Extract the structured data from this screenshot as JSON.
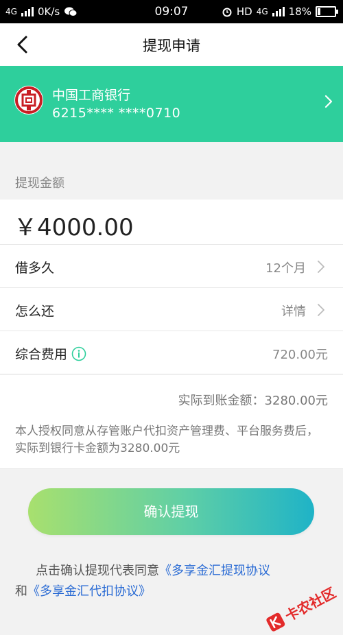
{
  "status_bar": {
    "network": "4G",
    "speed": "0K/s",
    "time": "09:07",
    "hd": "HD",
    "network_right": "4G",
    "battery": "18%",
    "battery_level": 0.18
  },
  "nav": {
    "title": "提现申请"
  },
  "bank_card": {
    "bank_name": "中国工商银行",
    "card_number": "6215**** ****0710"
  },
  "amount_section": {
    "label": "提现金额",
    "amount": "￥4000.00"
  },
  "rows": {
    "term": {
      "label": "借多久",
      "value": "12个月"
    },
    "repay": {
      "label": "怎么还",
      "value": "详情"
    },
    "fee": {
      "label": "综合费用",
      "value": "720.00元"
    }
  },
  "actual": {
    "amount_text": "实际到账金额：3280.00元",
    "description": "本人授权同意从存管账户代扣资产管理费、平台服务费后，实际到银行卡金额为3280.00元"
  },
  "confirm_button": {
    "label": "确认提现"
  },
  "agreement": {
    "prefix": "点击确认提现代表同意",
    "link1": "《多享金汇提现协议",
    "connector": "和",
    "link2": "《多享金汇代扣协议》"
  },
  "watermark": {
    "text": "卡农社区"
  },
  "colors": {
    "bank_card_bg": "#2ecf9c",
    "link": "#2a6bd4",
    "button_gradient_start": "#a8e06e",
    "button_gradient_end": "#1fb3c7"
  }
}
